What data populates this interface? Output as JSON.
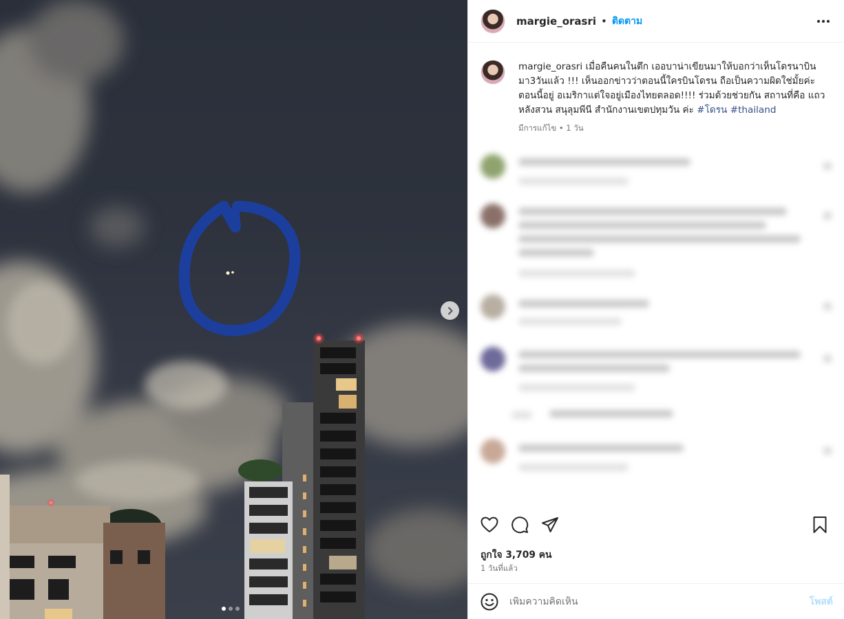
{
  "post": {
    "username": "margie_orasri",
    "follow_label": "ติดตาม",
    "separator": "•",
    "caption_username": "margie_orasri",
    "caption_text": "เมื่อคืนคนในตึก เออบาน่าเขียนมาให้บอกว่าเห็นโดรนาบินมา3วันแล้ว !!! เห็นออกข่าวว่าตอนนี้ใครบินโดรน ถือเป็นความผิดใช่มั้ยค่ะ ตอนนี้อยู่ อเมริกาแต่ใจอยู่เมืองไทยตลอด!!!! ร่วมด้วยช่วยกัน สถานที่คือ แถวหลังสวน สนุลุมพีนี สำนักงานเขตปทุมวัน ค่ะ",
    "hashtags": [
      "#โดรน",
      "#thailand"
    ],
    "caption_meta": "มีการแก้ไข • 1 วัน",
    "likes_text": "ถูกใจ 3,709 คน",
    "time_ago": "1 วันที่แล้ว"
  },
  "media": {
    "carousel_index": 1,
    "carousel_count": 3
  },
  "comment_box": {
    "placeholder": "เพิ่มความคิดเห็น",
    "post_label": "โพสต์"
  },
  "icons": {
    "more": "more-options-icon",
    "like": "heart-icon",
    "comment": "comment-icon",
    "share": "share-icon",
    "save": "bookmark-icon",
    "emoji": "emoji-icon",
    "next": "chevron-right-icon"
  },
  "colors": {
    "accent": "#0095f6",
    "hashtag": "#385185",
    "post_disabled": "#b2dffc",
    "circle_annotation": "#1c3f9e"
  }
}
